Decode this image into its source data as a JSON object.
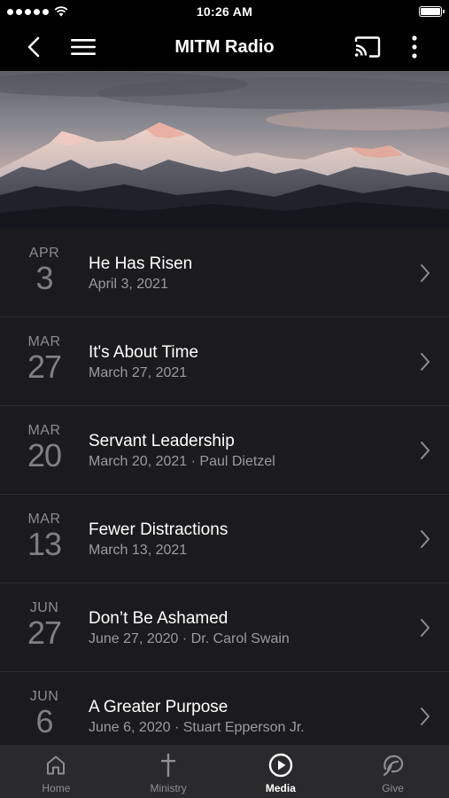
{
  "status_bar": {
    "time": "10:26 AM"
  },
  "app_bar": {
    "title": "MITM Radio"
  },
  "hero": {
    "icon": "mountain-banner"
  },
  "list": [
    {
      "month": "APR",
      "day": "3",
      "title": "He Has Risen",
      "subtitle": "April 3, 2021"
    },
    {
      "month": "MAR",
      "day": "27",
      "title": "It's About Time",
      "subtitle": "March 27, 2021"
    },
    {
      "month": "MAR",
      "day": "20",
      "title": "Servant Leadership",
      "subtitle": "March 20, 2021 · Paul Dietzel"
    },
    {
      "month": "MAR",
      "day": "13",
      "title": "Fewer Distractions",
      "subtitle": "March 13, 2021"
    },
    {
      "month": "JUN",
      "day": "27",
      "title": "Don’t Be Ashamed",
      "subtitle": "June 27, 2020 · Dr. Carol Swain"
    },
    {
      "month": "JUN",
      "day": "6",
      "title": "A Greater Purpose",
      "subtitle": "June 6, 2020 · Stuart Epperson Jr."
    }
  ],
  "tabs": [
    {
      "label": "Home",
      "icon": "home-icon"
    },
    {
      "label": "Ministry",
      "icon": "cross-icon"
    },
    {
      "label": "Media",
      "icon": "play-circle-icon",
      "active": true
    },
    {
      "label": "Give",
      "icon": "give-icon"
    }
  ],
  "colors": {
    "background": "#1b1b1d",
    "bar": "#000000",
    "tab_bar": "#2a2a2c",
    "muted": "#8c8c90"
  }
}
